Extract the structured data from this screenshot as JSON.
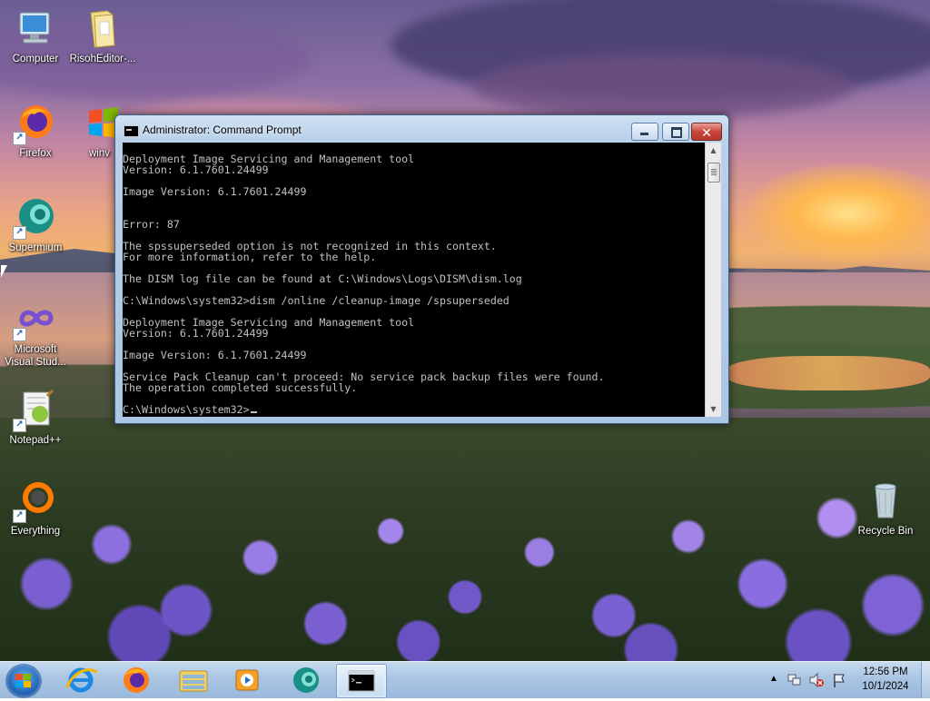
{
  "desktop": {
    "icons": [
      {
        "label": "Computer",
        "icon": "computer-icon"
      },
      {
        "label": "RisohEditor-...",
        "icon": "folder-icon"
      },
      {
        "label": "Firefox",
        "icon": "firefox-icon"
      },
      {
        "label": "winv",
        "icon": "windows-logo-icon"
      },
      {
        "label": "Supermium",
        "icon": "supermium-icon"
      },
      {
        "label": "Microsoft Visual Stud...",
        "icon": "visual-studio-icon"
      },
      {
        "label": "Notepad++",
        "icon": "notepadplusplus-icon"
      },
      {
        "label": "Everything",
        "icon": "everything-search-icon"
      },
      {
        "label": "Recycle Bin",
        "icon": "recycle-bin-icon"
      }
    ]
  },
  "cmd_window": {
    "title": "Administrator: Command Prompt",
    "lines": [
      "Deployment Image Servicing and Management tool",
      "Version: 6.1.7601.24499",
      "",
      "Image Version: 6.1.7601.24499",
      "",
      "",
      "Error: 87",
      "",
      "The spssuperseded option is not recognized in this context.",
      "For more information, refer to the help.",
      "",
      "The DISM log file can be found at C:\\Windows\\Logs\\DISM\\dism.log",
      "",
      "C:\\Windows\\system32>dism /online /cleanup-image /spsuperseded",
      "",
      "Deployment Image Servicing and Management tool",
      "Version: 6.1.7601.24499",
      "",
      "Image Version: 6.1.7601.24499",
      "",
      "Service Pack Cleanup can't proceed: No service pack backup files were found.",
      "The operation completed successfully.",
      "",
      "C:\\Windows\\system32>"
    ]
  },
  "taskbar": {
    "pinned": [
      {
        "name": "internet-explorer-icon"
      },
      {
        "name": "firefox-icon"
      },
      {
        "name": "file-explorer-icon"
      },
      {
        "name": "media-player-icon"
      },
      {
        "name": "supermium-icon"
      },
      {
        "name": "command-prompt-icon"
      }
    ],
    "clock_time": "12:56 PM",
    "clock_date": "10/1/2024"
  }
}
